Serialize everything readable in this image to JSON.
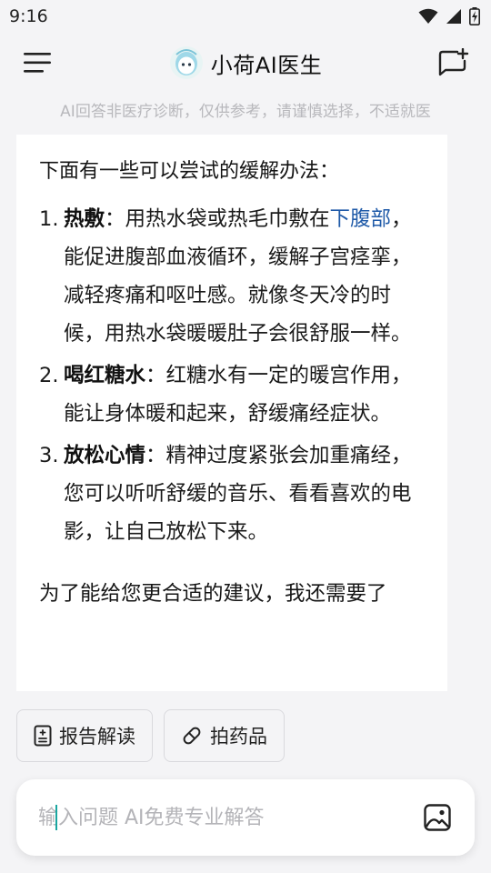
{
  "status_bar": {
    "time": "9:16"
  },
  "header": {
    "title": "小荷AI医生"
  },
  "disclaimer": "AI回答非医疗诊断，仅供参考，请谨慎选择，不适就医",
  "message": {
    "intro": "下面有一些可以尝试的缓解办法：",
    "tips": [
      {
        "num": "1.",
        "title": "热敷",
        "sep": "：",
        "before": "用热水袋或热毛巾敷在",
        "highlight": "下腹部",
        "after": "，能促进腹部血液循环，缓解子宫痉挛，减轻疼痛和呕吐感。就像冬天冷的时候，用热水袋暖暖肚子会很舒服一样。"
      },
      {
        "num": "2.",
        "title": "喝红糖水",
        "sep": "：",
        "text": "红糖水有一定的暖宫作用，能让身体暖和起来，舒缓痛经症状。"
      },
      {
        "num": "3.",
        "title": "放松心情",
        "sep": "：",
        "text": "精神过度紧张会加重痛经，您可以听听舒缓的音乐、看看喜欢的电影，让自己放松下来。"
      }
    ],
    "outro": "为了能给您更合适的建议，我还需要了"
  },
  "quick_actions": [
    {
      "label": "报告解读",
      "icon": "report-icon"
    },
    {
      "label": "拍药品",
      "icon": "pill-icon"
    }
  ],
  "input": {
    "placeholder": "输入问题 AI免费专业解答",
    "value": ""
  },
  "colors": {
    "accent": "#1aa6a0",
    "link": "#1f5aa8",
    "disclaimer": "#b8b8bc"
  }
}
